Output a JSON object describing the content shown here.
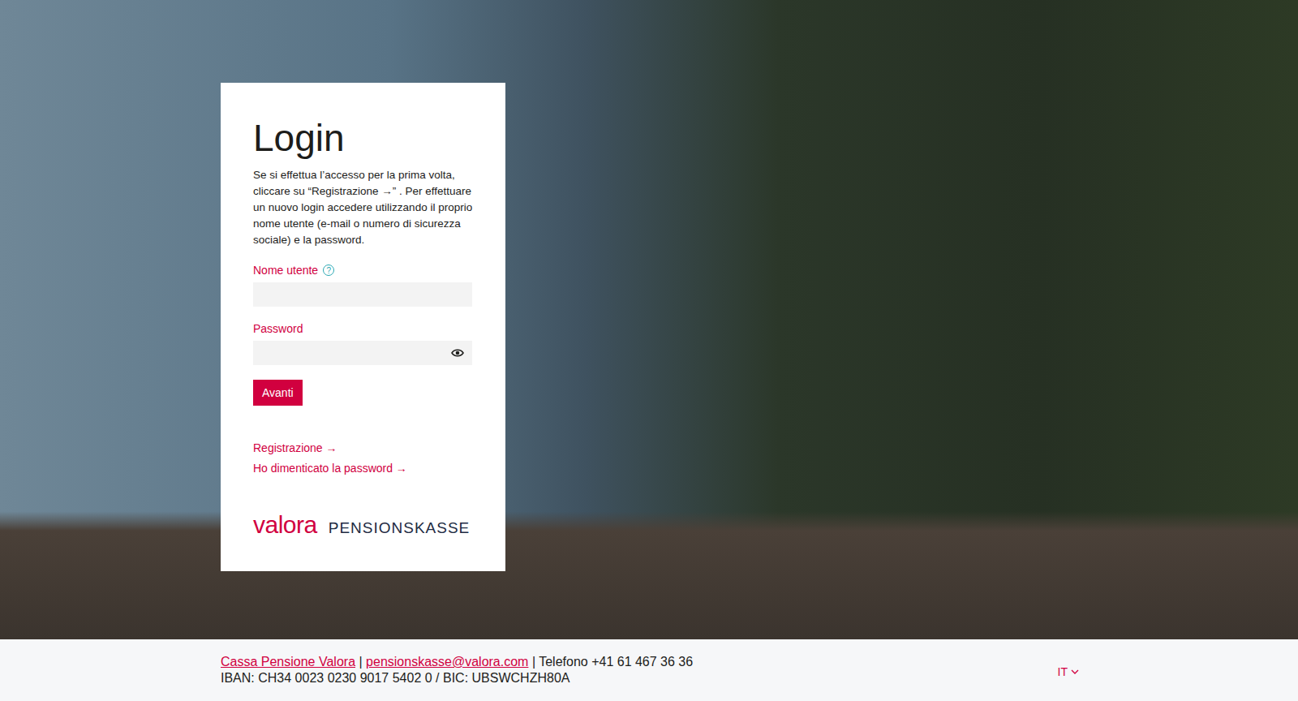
{
  "login": {
    "title": "Login",
    "intro": "Se si effettua l’accesso per la prima volta, cliccare su “Registrazione →” . Per effettuare un nuovo login accedere utilizzando il proprio nome utente (e-mail o numero di sicurezza sociale) e la password.",
    "username_label": "Nome utente",
    "username_help": "?",
    "username_value": "",
    "password_label": "Password",
    "password_value": "",
    "submit": "Avanti",
    "links": [
      "Registrazione →",
      "Ho dimenticato la password →"
    ]
  },
  "logo": {
    "brand": "valora",
    "product": "PENSIONSKASSE"
  },
  "footer": {
    "org_link": "Cassa Pensione Valora",
    "sep1": "|",
    "email": "pensionskasse@valora.com",
    "phone": "| Telefono +41 61 467 36 36",
    "bank": "IBAN: CH34 0023 0230 9017 5402 0 / BIC: UBSWCHZH80A",
    "language": "IT"
  }
}
